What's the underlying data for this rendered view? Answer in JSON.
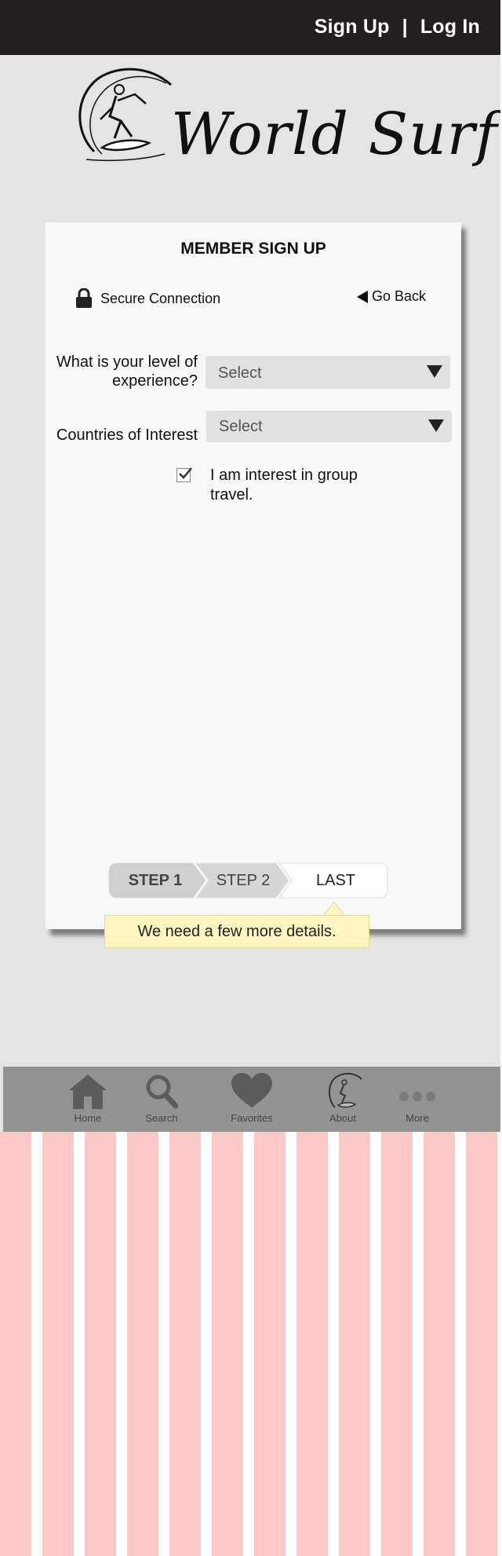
{
  "header": {
    "signup_label": "Sign Up",
    "separator": "|",
    "login_label": "Log In"
  },
  "logo": {
    "text": "World Surf"
  },
  "card": {
    "title": "MEMBER SIGN UP",
    "secure_label": "Secure Connection",
    "goback_label": "Go Back",
    "experience_label": "What is your level of experience?",
    "experience_value": "Select",
    "countries_label": "Countries of Interest",
    "countries_value": "Select",
    "group_travel_label": "I am interest in group travel.",
    "group_travel_checked": true
  },
  "steps": [
    {
      "label": "STEP 1"
    },
    {
      "label": "STEP 2"
    },
    {
      "label": "LAST"
    }
  ],
  "tooltip": {
    "text": "We need a few more details."
  },
  "bottomnav": {
    "items": [
      {
        "label": "Home",
        "icon": "home-icon"
      },
      {
        "label": "Search",
        "icon": "search-icon"
      },
      {
        "label": "Favorites",
        "icon": "heart-icon"
      },
      {
        "label": "About",
        "icon": "surfer-logo-icon"
      },
      {
        "label": "More",
        "icon": "more-icon"
      }
    ]
  },
  "colors": {
    "topbar": "#231f20",
    "screen_bg": "#e4e4e4",
    "card_bg": "#f8f8f8",
    "select_bg": "#e1e1e1",
    "nav_bg": "#939393",
    "tooltip_bg": "#fdf6c0",
    "stripe": "#ffc9ca"
  }
}
